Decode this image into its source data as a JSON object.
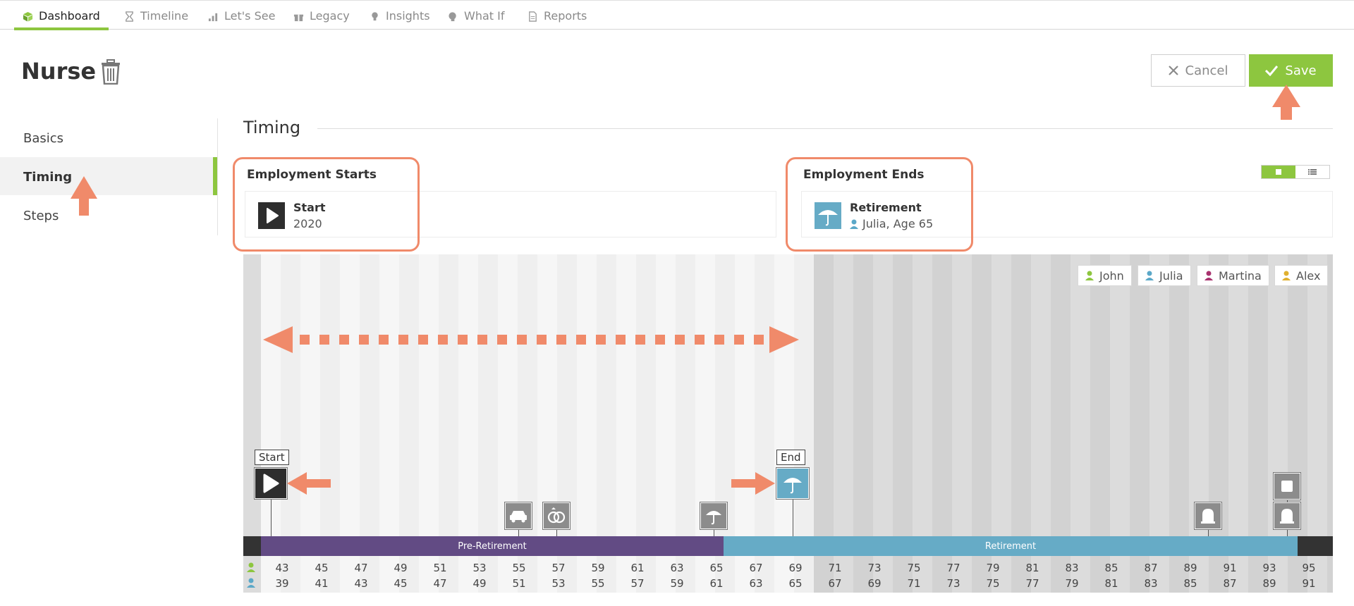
{
  "nav": {
    "tabs": [
      {
        "label": "Dashboard",
        "icon": "cube-icon",
        "active": true
      },
      {
        "label": "Timeline",
        "icon": "hourglass-icon"
      },
      {
        "label": "Let's See",
        "icon": "bar-chart-icon"
      },
      {
        "label": "Legacy",
        "icon": "gift-icon"
      },
      {
        "label": "Insights",
        "icon": "lightbulb-icon"
      },
      {
        "label": "What If",
        "icon": "brain-icon"
      },
      {
        "label": "Reports",
        "icon": "document-icon"
      }
    ]
  },
  "page": {
    "title": "Nurse"
  },
  "actions": {
    "cancel": "Cancel",
    "save": "Save"
  },
  "sidebar": {
    "items": [
      {
        "label": "Basics"
      },
      {
        "label": "Timing",
        "active": true
      },
      {
        "label": "Steps"
      }
    ]
  },
  "section": {
    "title": "Timing"
  },
  "employment_starts": {
    "label": "Employment Starts",
    "title": "Start",
    "sub": "2020"
  },
  "employment_ends": {
    "label": "Employment Ends",
    "title": "Retirement",
    "sub": "Julia, Age 65"
  },
  "timeline": {
    "legend": [
      {
        "name": "John",
        "color": "#8dc63f"
      },
      {
        "name": "Julia",
        "color": "#5ba8c8"
      },
      {
        "name": "Martina",
        "color": "#a8326e"
      },
      {
        "name": "Alex",
        "color": "#e0b030"
      }
    ],
    "phases": [
      {
        "label": "Pre-Retirement",
        "color": "#624b84"
      },
      {
        "label": "Retirement",
        "color": "#66abc6"
      }
    ],
    "markers": {
      "start": "Start",
      "end": "End"
    },
    "john_ages": [
      "43",
      "45",
      "47",
      "49",
      "51",
      "53",
      "55",
      "57",
      "59",
      "61",
      "63",
      "65",
      "67",
      "69",
      "71",
      "73",
      "75",
      "77",
      "79",
      "81",
      "83",
      "85",
      "87",
      "89",
      "91",
      "93",
      "95"
    ],
    "julia_ages": [
      "39",
      "41",
      "43",
      "45",
      "47",
      "49",
      "51",
      "53",
      "55",
      "57",
      "59",
      "61",
      "63",
      "65",
      "67",
      "69",
      "71",
      "73",
      "75",
      "77",
      "79",
      "81",
      "83",
      "85",
      "87",
      "89",
      "91"
    ],
    "events": [
      "car-icon",
      "rings-icon",
      "umbrella-icon",
      "tombstone-icon",
      "tombstone-icon",
      "square-icon"
    ]
  },
  "colors": {
    "accent": "#8dc63f",
    "callout": "#f08a6a",
    "dark": "#333333"
  }
}
